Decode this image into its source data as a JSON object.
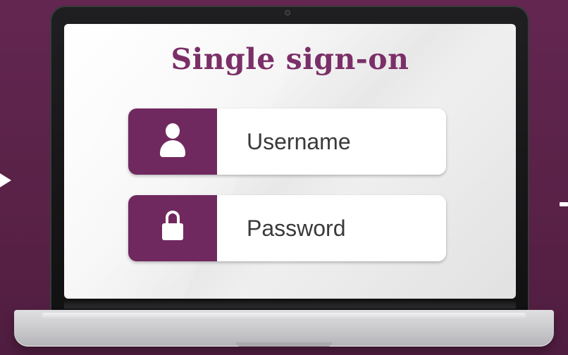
{
  "window": {
    "title": "Single sign-on"
  },
  "login": {
    "username_label": "Username",
    "password_label": "Password"
  },
  "icons": {
    "username": "user-icon",
    "password": "lock-icon"
  },
  "colors": {
    "background": "#5e2449",
    "accent": "#70295f",
    "title": "#7b2f68",
    "field_text": "#3a3a3a"
  }
}
